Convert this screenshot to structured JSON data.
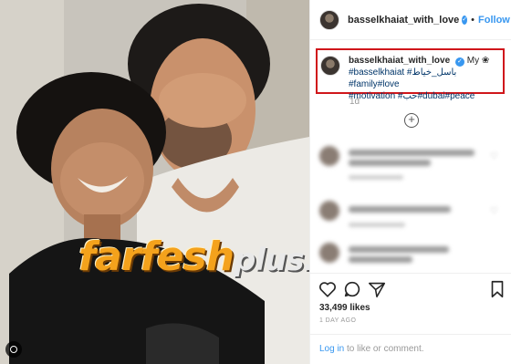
{
  "post": {
    "username": "basselkhaiat_with_love",
    "verified_icon": "verified-badge-icon",
    "follow_label": "Follow",
    "separator": "•"
  },
  "caption": {
    "username": "basselkhaiat_with_love",
    "line1_text": "My ❀",
    "hashtags_line2": "#basselkhaiat #باسل_خياط #family#love",
    "hashtags_line3": "#motivation #حب#dubai#peace",
    "time": "1d"
  },
  "actions": {
    "like_icon": "heart-icon",
    "comment_icon": "comment-icon",
    "share_icon": "share-icon",
    "save_icon": "bookmark-icon",
    "likes": "33,499 likes",
    "posted": "1 DAY AGO"
  },
  "comment_form": {
    "login_link": "Log in",
    "login_rest": " to like or comment."
  },
  "watermark": {
    "main": "farfesh",
    "sub": "plus.com"
  },
  "colors": {
    "accent": "#3897f0",
    "highlight_border": "#d0161b",
    "hashtag": "#003569"
  }
}
